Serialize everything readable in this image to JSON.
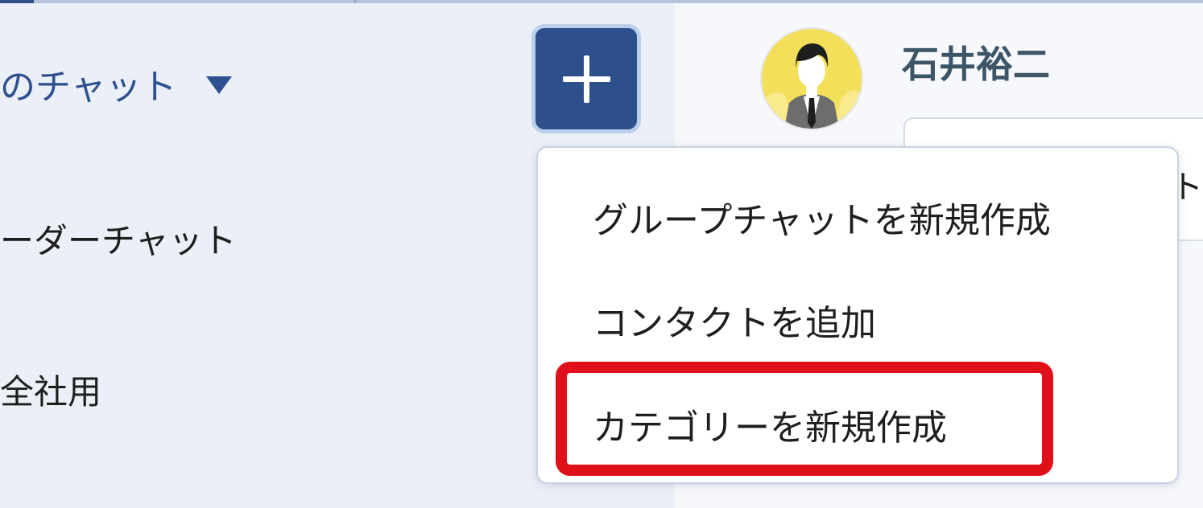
{
  "sidebar": {
    "chat_heading": "のチャット",
    "items": [
      {
        "label": "ーダーチャット"
      },
      {
        "label": "全社用"
      }
    ]
  },
  "header": {
    "user_name": "石井裕二",
    "new_button_icon": "plus-icon"
  },
  "dropdown": {
    "items": [
      {
        "label": "グループチャットを新規作成"
      },
      {
        "label": "コンタクトを追加"
      },
      {
        "label": "カテゴリーを新規作成"
      }
    ],
    "highlighted_index": 2,
    "highlight_color": "#e0101a"
  },
  "message_peek": "ト",
  "colors": {
    "accent": "#2f508f",
    "sidebar_bg": "#ebeff7"
  }
}
